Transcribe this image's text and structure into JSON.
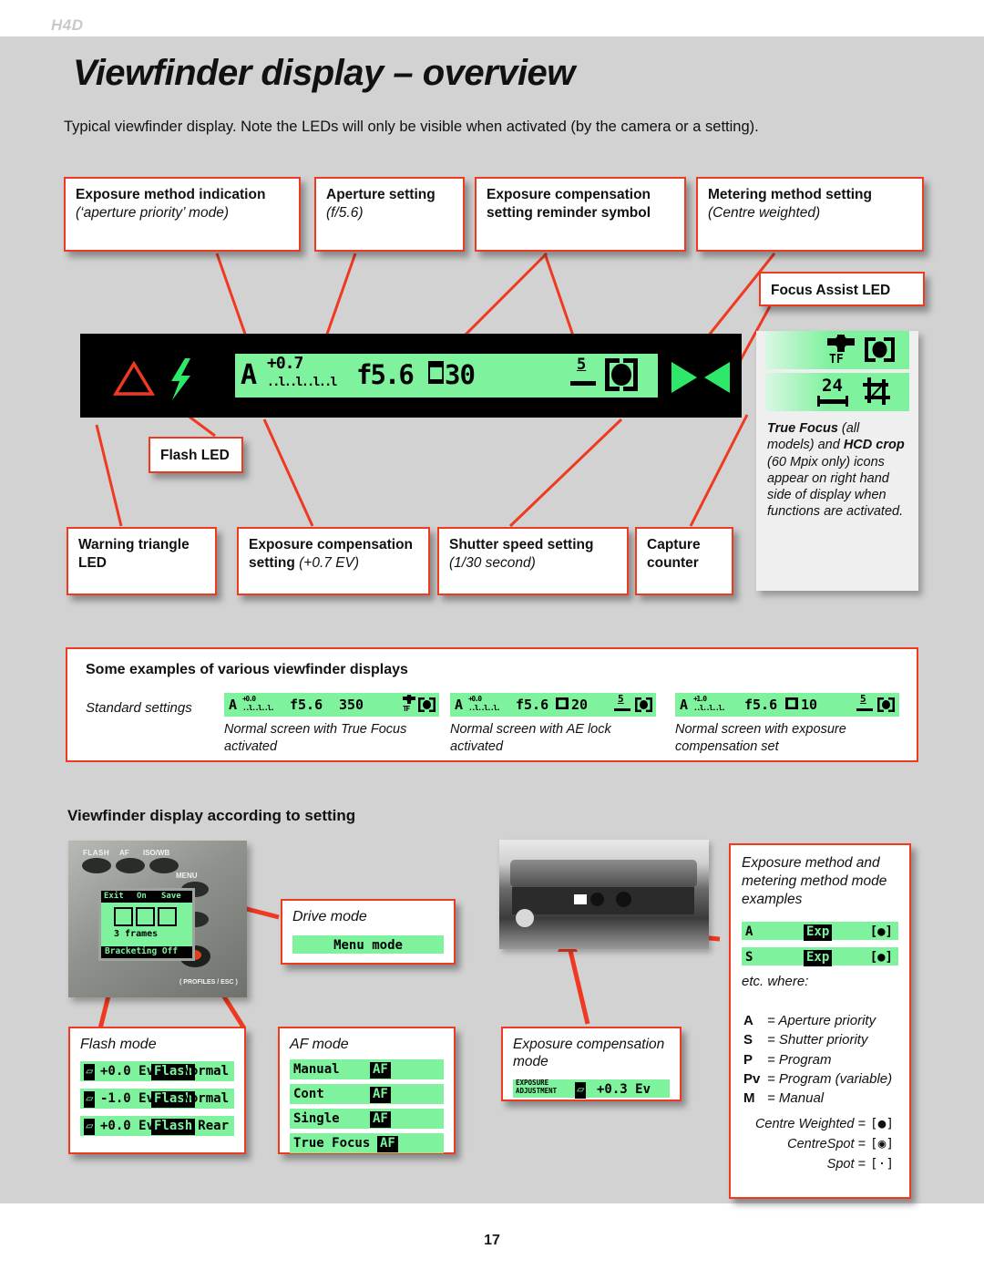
{
  "header": {
    "model_tag": "H4D",
    "title": "Viewfinder display – overview",
    "intro": "Typical viewfinder display. Note the LEDs will only be visible when activated (by the camera or a setting)."
  },
  "footer": {
    "page_number": "17"
  },
  "colors": {
    "callout_border": "#ef3a21",
    "lcd_green": "#7ef29d",
    "page_grey": "#d2d2d2",
    "led_red": "#ef3a21",
    "led_green": "#2ee86a"
  },
  "callouts_top": [
    {
      "title": "Exposure method indication",
      "sub": "(‘aperture priority’ mode)"
    },
    {
      "title": "Aperture setting",
      "sub": "(f/5.6)"
    },
    {
      "title": "Exposure compensation setting reminder symbol",
      "sub": ""
    },
    {
      "title": "Metering method setting",
      "sub": "(Centre weighted)"
    }
  ],
  "callout_focus_assist": {
    "title": "Focus Assist LED"
  },
  "callout_flash_led": {
    "title": "Flash LED"
  },
  "callouts_bottom": [
    {
      "title": "Warning triangle LED",
      "sub": ""
    },
    {
      "title": "Exposure compensation setting",
      "sub": "(+0.7 EV)"
    },
    {
      "title": "Shutter speed setting",
      "sub": "(1/30 second)"
    },
    {
      "title": "Capture counter",
      "sub": ""
    }
  ],
  "main_lcd": {
    "exposure_method": "A",
    "exposure_comp": "+0.7",
    "comp_scale": "..l..l..l..l",
    "aperture": "f5.6",
    "ae_lock_symbol": "⬛",
    "shutter_speed": "30",
    "capture_counter": "5",
    "metering_symbol": "centre-weighted",
    "warning_triangle": "warning-triangle-led",
    "flash_led": "flash-bolt-led",
    "focus_arrows": "focus-assist-arrows"
  },
  "right_panel": {
    "row1_tf": "TF",
    "row1_meter": "[●]",
    "row2_count": "24",
    "row2_crop": "crop-icon",
    "note_parts": {
      "b1": "True Focus",
      "t1": " (all models) and ",
      "b2": "HCD crop",
      "t2": " (60 Mpix only) icons appear on right hand side of display when functions are activated."
    }
  },
  "examples_section": {
    "heading": "Some examples of various viewfinder displays",
    "standard_label": "Standard settings",
    "items": [
      {
        "method": "A",
        "comp": "+0.0",
        "aperture": "f5.6",
        "shutter": "350",
        "right_tf": "TF",
        "meter": "[●]",
        "counter": "",
        "caption": "Normal screen with True Focus activated"
      },
      {
        "method": "A",
        "comp": "+0.0",
        "aperture": "f5.6",
        "shutter": "20",
        "ae_lock": true,
        "counter": "5",
        "meter": "[●]",
        "caption": "Normal screen with AE lock activated"
      },
      {
        "method": "A",
        "comp": "+1.0",
        "aperture": "f5.6",
        "shutter": "10",
        "ae_lock": true,
        "counter": "5",
        "meter": "[●]",
        "caption": "Normal screen with exposure compensation set"
      }
    ]
  },
  "lower_section": {
    "heading": "Viewfinder display according to setting",
    "grip_photo": {
      "button_flash": "FLASH",
      "button_af": "AF",
      "button_isowb": "ISO/WB",
      "button_menu": "MENU",
      "button_profiles": "( PROFILES / ESC )",
      "screen_top_left": "Exit",
      "screen_top_mid": "On",
      "screen_top_right": "Save",
      "screen_frames": "3 frames",
      "screen_bottom": "Bracketing Off"
    },
    "drive_mode": {
      "title": "Drive mode",
      "bar_text": "Menu mode"
    },
    "flash_mode": {
      "title": "Flash mode",
      "rows": [
        {
          "ev": "+0.0 Ev",
          "chip": "Flash",
          "right": "Normal"
        },
        {
          "ev": "-1.0 Ev",
          "chip": "Flash",
          "right": "Normal"
        },
        {
          "ev": "+0.0 Ev",
          "chip": "Flash",
          "right": "Rear"
        }
      ]
    },
    "af_mode": {
      "title": "AF mode",
      "rows": [
        {
          "label": "Manual",
          "chip": "AF"
        },
        {
          "label": "Cont",
          "chip": "AF"
        },
        {
          "label": "Single",
          "chip": "AF"
        },
        {
          "label": "True Focus",
          "chip": "AF"
        }
      ]
    },
    "exposure_comp_mode": {
      "title": "Exposure compensation mode",
      "bar_label1": "EXPOSURE",
      "bar_label2": "ADJUSTMENT",
      "bar_value": "+0.3 Ev"
    },
    "exposure_method_panel": {
      "title": "Exposure method and metering method mode examples",
      "rows": [
        {
          "method": "A",
          "chip": "Exp",
          "meter": "[●]"
        },
        {
          "method": "S",
          "chip": "Exp",
          "meter": "[●]"
        }
      ],
      "etc": "etc. where:",
      "legend": [
        {
          "key": "A",
          "desc": "= Aperture priority"
        },
        {
          "key": "S",
          "desc": "= Shutter priority"
        },
        {
          "key": "P",
          "desc": "= Program"
        },
        {
          "key": "Pv",
          "desc": "= Program (variable)"
        },
        {
          "key": "M",
          "desc": "= Manual"
        }
      ],
      "meter_legend": [
        {
          "name": "Centre Weighted =",
          "sym": "[●]"
        },
        {
          "name": "CentreSpot =",
          "sym": "[◉]"
        },
        {
          "name": "Spot =",
          "sym": "[·]"
        }
      ]
    }
  }
}
